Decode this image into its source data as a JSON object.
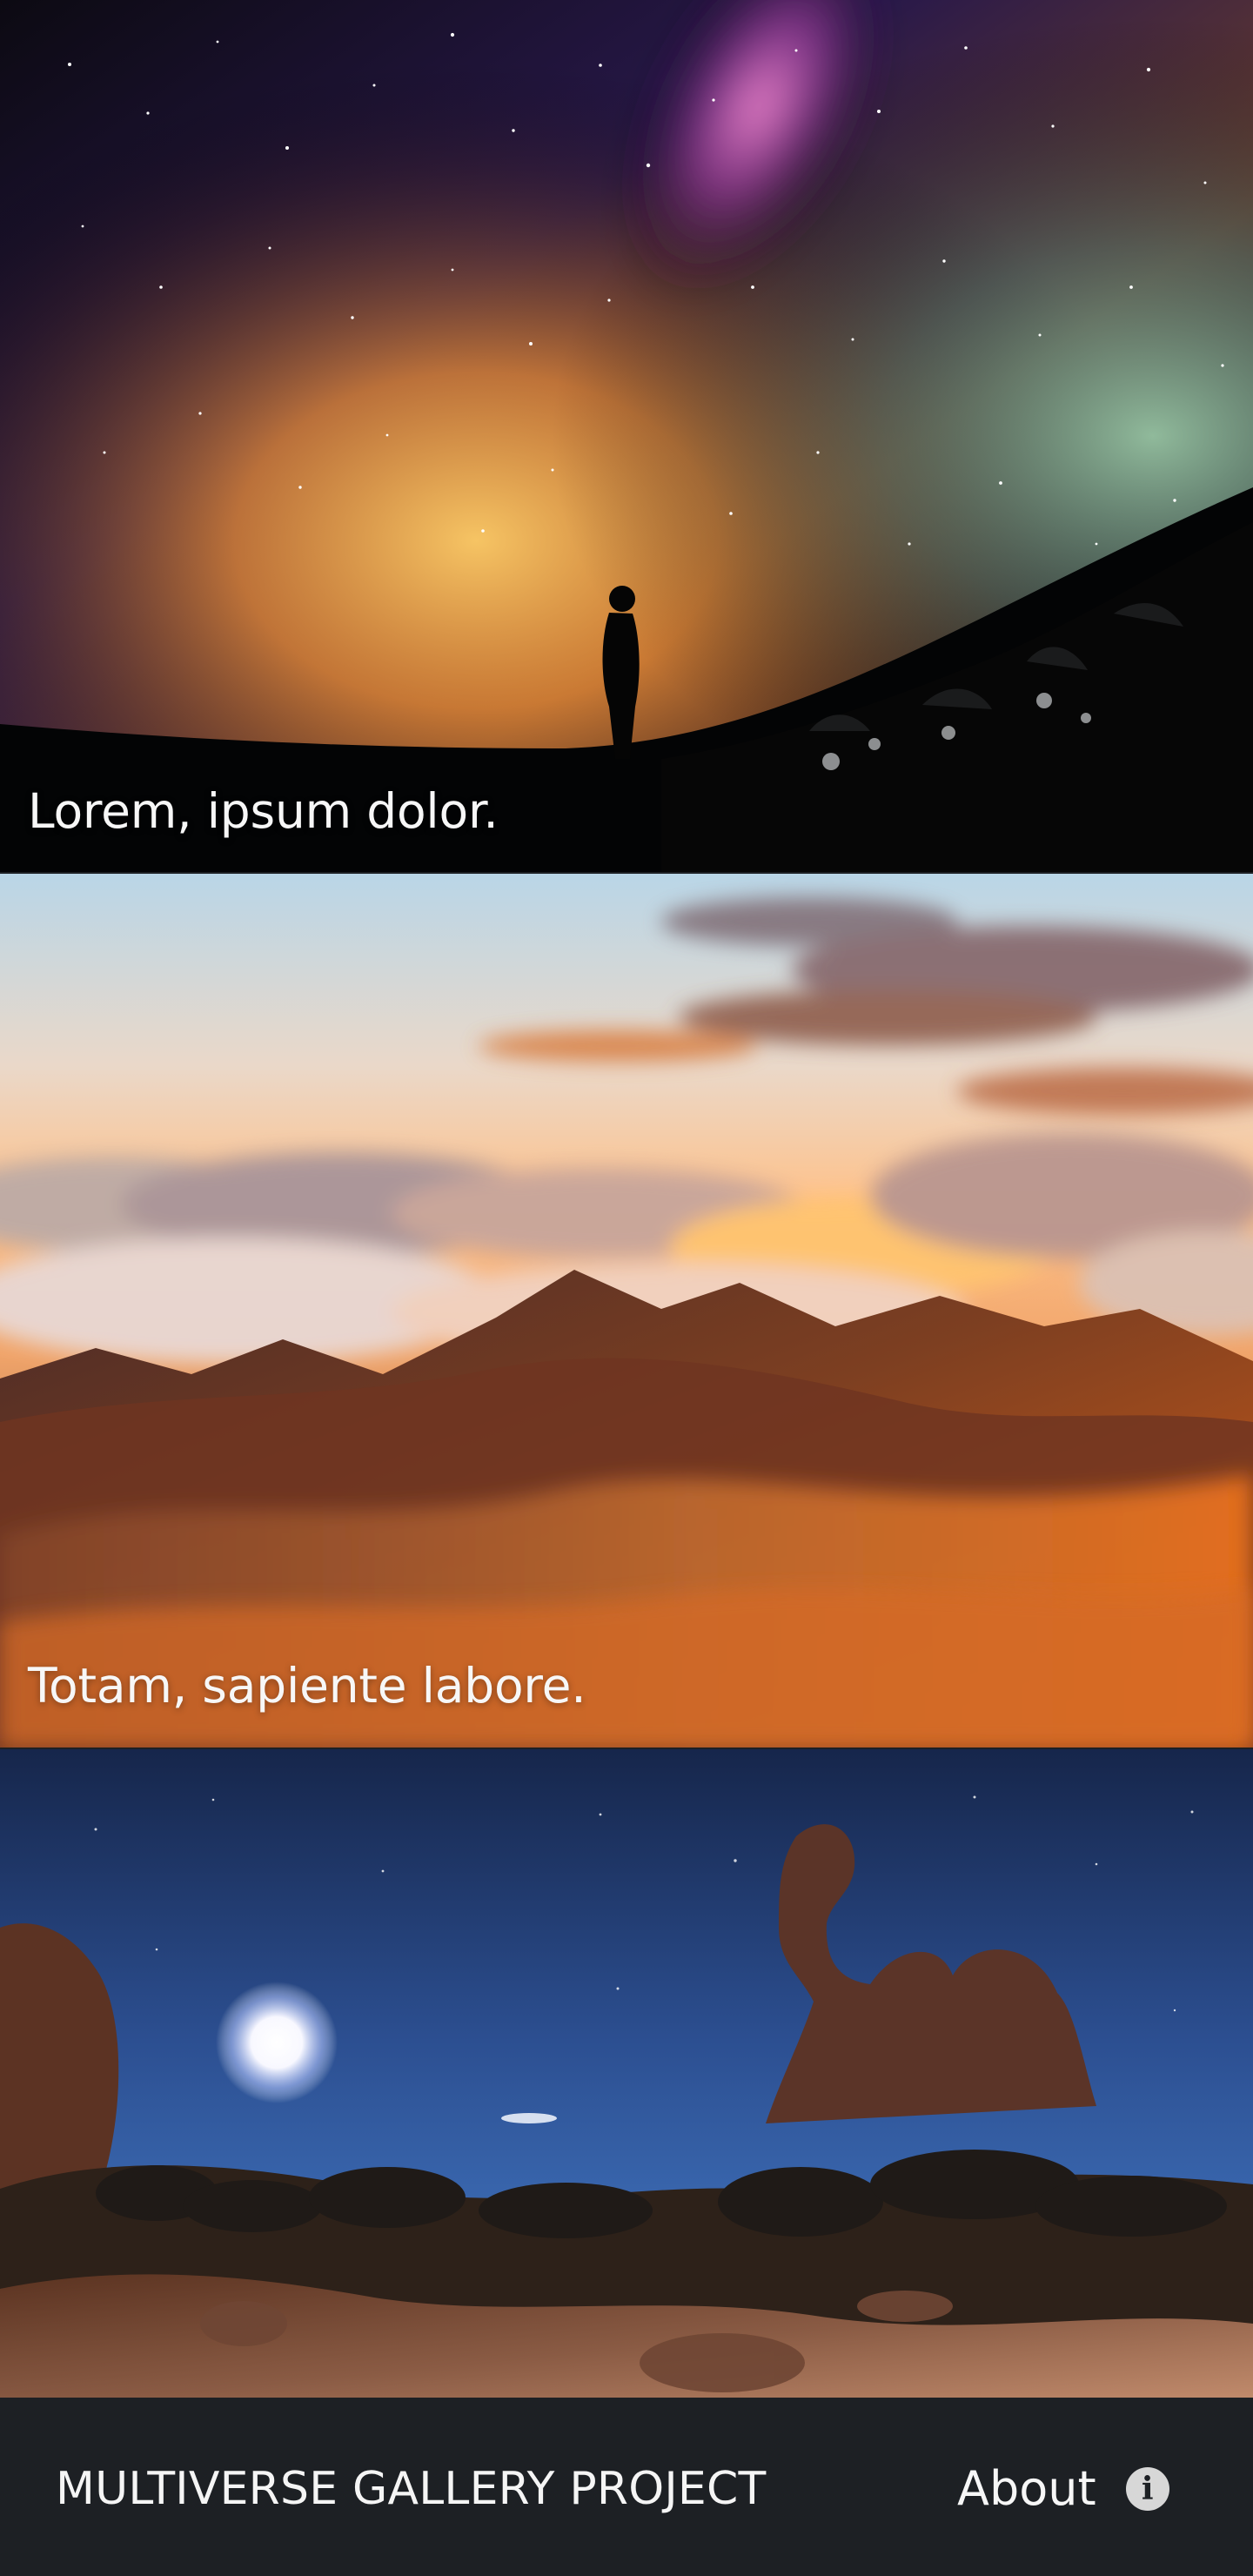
{
  "gallery": {
    "items": [
      {
        "caption": "Lorem, ipsum dolor.",
        "image_icon": "milky-way-silhouette-image"
      },
      {
        "caption": "Totam, sapiente labore.",
        "image_icon": "mountain-clouds-image"
      },
      {
        "caption": "",
        "image_icon": "desert-arch-night-image"
      }
    ]
  },
  "footer": {
    "title": "MULTIVERSE GALLERY PROJECT",
    "about_label": "About",
    "about_icon": "info-icon",
    "info_symbol": "i"
  },
  "colors": {
    "footer_background": "#1d2024",
    "text": "#f5f5f5",
    "info_icon_background": "#d7d7d7"
  }
}
